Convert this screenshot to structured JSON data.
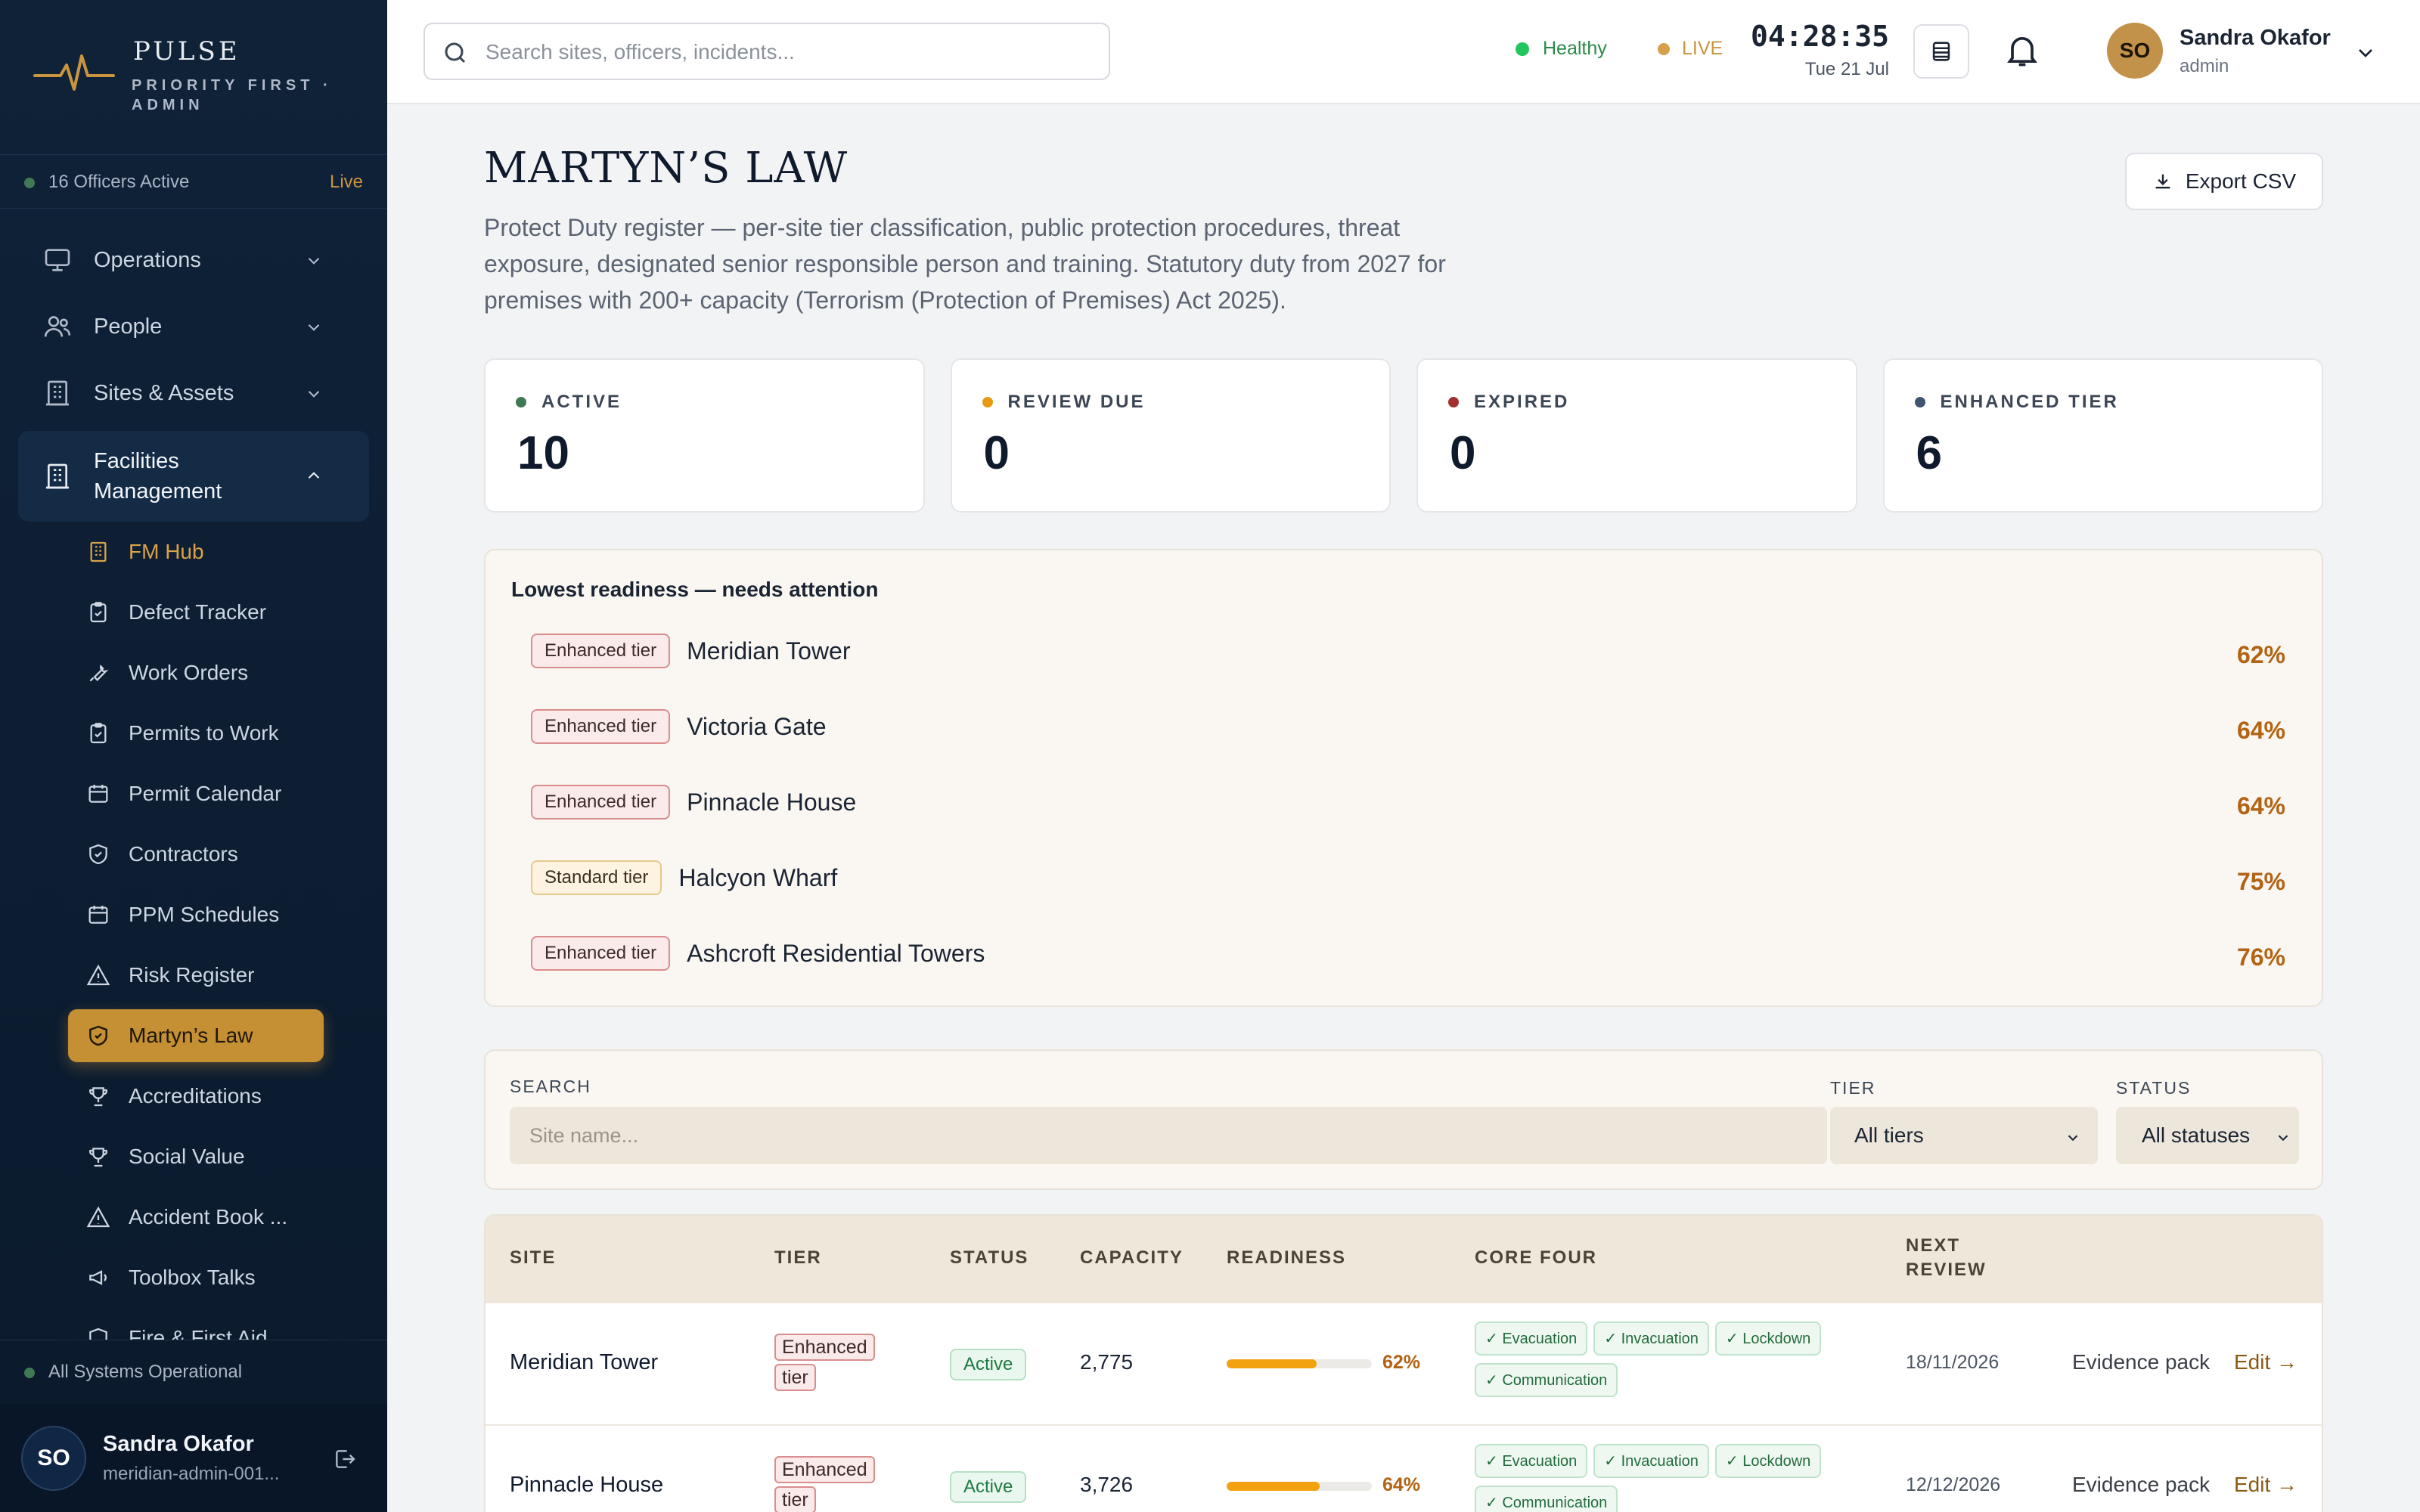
{
  "brand": {
    "name": "PULSE",
    "subtitle": "PRIORITY FIRST · ADMIN"
  },
  "sidebar": {
    "officers_active": "16 Officers Active",
    "live_label": "Live",
    "nav": [
      {
        "label": "Operations",
        "icon": "monitor-icon"
      },
      {
        "label": "People",
        "icon": "people-icon"
      },
      {
        "label": "Sites & Assets",
        "icon": "building-icon"
      },
      {
        "label": "Facilities Management",
        "icon": "building-icon",
        "expanded": true
      }
    ],
    "sub_items": [
      {
        "label": "FM Hub",
        "icon": "building-icon"
      },
      {
        "label": "Defect Tracker",
        "icon": "clipboard-icon"
      },
      {
        "label": "Work Orders",
        "icon": "wrench-icon"
      },
      {
        "label": "Permits to Work",
        "icon": "clipboard-icon"
      },
      {
        "label": "Permit Calendar",
        "icon": "calendar-icon"
      },
      {
        "label": "Contractors",
        "icon": "shield-icon"
      },
      {
        "label": "PPM Schedules",
        "icon": "calendar-icon"
      },
      {
        "label": "Risk Register",
        "icon": "warning-icon"
      },
      {
        "label": "Martyn’s Law",
        "icon": "shield-icon",
        "active": true
      },
      {
        "label": "Accreditations",
        "icon": "trophy-icon"
      },
      {
        "label": "Social Value",
        "icon": "trophy-icon"
      },
      {
        "label": "Accident Book ...",
        "icon": "warning-icon"
      },
      {
        "label": "Toolbox Talks",
        "icon": "megaphone-icon"
      },
      {
        "label": "Fire & First Aid",
        "icon": "shield-icon"
      }
    ],
    "system_status": "All Systems Operational",
    "user": {
      "initials": "SO",
      "name": "Sandra Okafor",
      "id": "meridian-admin-001..."
    }
  },
  "topbar": {
    "search_placeholder": "Search sites, officers, incidents...",
    "health": "Healthy",
    "live": "LIVE",
    "time": "04:28:35",
    "date": "Tue 21 Jul",
    "user": {
      "initials": "SO",
      "name": "Sandra Okafor",
      "role": "admin"
    }
  },
  "page": {
    "title": "MARTYN’S LAW",
    "description": "Protect Duty register — per-site tier classification, public protection procedures, threat exposure, designated senior responsible person and training. Statutory duty from 2027 for premises with 200+ capacity (Terrorism (Protection of Premises) Act 2025).",
    "export_label": "Export CSV"
  },
  "stats": [
    {
      "label": "ACTIVE",
      "value": "10",
      "color": "#3f7a55"
    },
    {
      "label": "REVIEW DUE",
      "value": "0",
      "color": "#e59a12"
    },
    {
      "label": "EXPIRED",
      "value": "0",
      "color": "#a33030"
    },
    {
      "label": "ENHANCED TIER",
      "value": "6",
      "color": "#3f556f"
    }
  ],
  "lowest": {
    "title": "Lowest readiness — needs attention",
    "rows": [
      {
        "tier": "Enhanced tier",
        "tier_type": "enh",
        "name": "Meridian Tower",
        "pct": "62%"
      },
      {
        "tier": "Enhanced tier",
        "tier_type": "enh",
        "name": "Victoria Gate",
        "pct": "64%"
      },
      {
        "tier": "Enhanced tier",
        "tier_type": "enh",
        "name": "Pinnacle House",
        "pct": "64%"
      },
      {
        "tier": "Standard tier",
        "tier_type": "std",
        "name": "Halcyon Wharf",
        "pct": "75%"
      },
      {
        "tier": "Enhanced tier",
        "tier_type": "enh",
        "name": "Ashcroft Residential Towers",
        "pct": "76%"
      }
    ]
  },
  "filters": {
    "search_label": "SEARCH",
    "search_placeholder": "Site name...",
    "tier_label": "TIER",
    "tier_value": "All tiers",
    "status_label": "STATUS",
    "status_value": "All statuses"
  },
  "table": {
    "columns": [
      "SITE",
      "TIER",
      "STATUS",
      "CAPACITY",
      "READINESS",
      "CORE FOUR",
      "NEXT REVIEW"
    ],
    "rows": [
      {
        "site": "Meridian Tower",
        "tier_line1": "Enhanced",
        "tier_line2": "tier",
        "status": "Active",
        "capacity": "2,775",
        "readiness": 0.62,
        "readiness_label": "62%",
        "core_four": [
          "✓ Evacuation",
          "✓ Invacuation",
          "✓ Lockdown",
          "✓ Communication"
        ],
        "next_review": "18/11/2026",
        "evidence": "Evidence pack",
        "edit": "Edit →"
      },
      {
        "site": "Pinnacle House",
        "tier_line1": "Enhanced",
        "tier_line2": "tier",
        "status": "Active",
        "capacity": "3,726",
        "readiness": 0.64,
        "readiness_label": "64%",
        "core_four": [
          "✓ Evacuation",
          "✓ Invacuation",
          "✓ Lockdown",
          "✓ Communication"
        ],
        "next_review": "12/12/2026",
        "evidence": "Evidence pack",
        "edit": "Edit →"
      }
    ]
  }
}
